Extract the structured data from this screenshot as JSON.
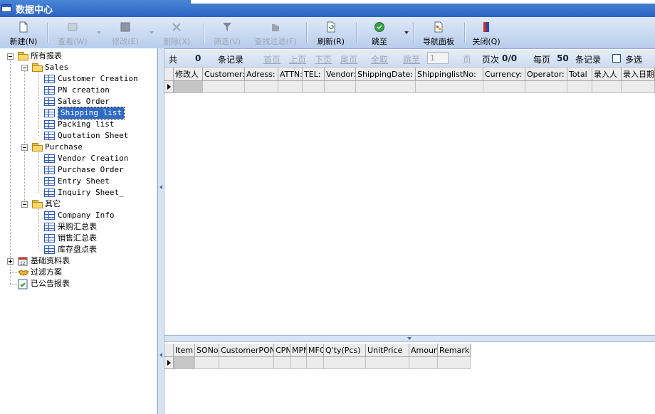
{
  "window": {
    "title": "数据中心"
  },
  "toolbar": {
    "new": "新建(N)",
    "view": "查看(W)",
    "edit": "修改(E)",
    "delete": "删除(X)",
    "filter": "筛选(V)",
    "find_filter": "查找过滤(F)",
    "refresh": "刷新(R)",
    "jump": "跳至",
    "nav_panel": "导航面板",
    "close": "关闭(Q)"
  },
  "tree": {
    "root": "所有报表",
    "sales": {
      "label": "Sales",
      "items": [
        "Customer Creation",
        "PN creation",
        "Sales Order",
        "Shipping list",
        "Packing list",
        "Quotation Sheet"
      ],
      "selected": "Shipping list"
    },
    "purchase": {
      "label": "Purchase",
      "items": [
        "Vendor Creation",
        "Purchase Order",
        "Entry Sheet",
        "Inquiry Sheet_"
      ]
    },
    "other": {
      "label": "其它",
      "items": [
        "Company Info",
        "采购汇总表",
        "销售汇总表",
        "库存盘点表"
      ]
    },
    "basic": "基础资料表",
    "filter_scheme": "过滤方案",
    "published": "已公告报表"
  },
  "navbar": {
    "total_prefix": "共",
    "total_count": "0",
    "records_label": "条记录",
    "first": "首页",
    "prev": "上页",
    "next": "下页",
    "last": "尾页",
    "select_all": "全取",
    "jump_to": "跳至",
    "page_input": "1",
    "page_unit": "页",
    "page_label": "页次",
    "page_value": "0/0",
    "per_page_label": "每页",
    "per_page_value": "50",
    "per_page_records": "条记录",
    "multi_select": "多选"
  },
  "main_grid": {
    "columns": [
      "修改人",
      "Customer:",
      "Adress:",
      "ATTN:",
      "TEL:",
      "Vendor:",
      "ShippingDate:",
      "ShippinglistNo:",
      "Currency:",
      "Operator:",
      "Total",
      "录入人",
      "录入日期"
    ]
  },
  "detail_grid": {
    "columns": [
      "Item",
      "SONo.",
      "CustomerPONo",
      "CPN",
      "MPN",
      "MFG",
      "Q'ty(Pcs)",
      "UnitPrice",
      "Amount",
      "Remarks"
    ]
  },
  "colors": {
    "title_bar": "#2d62c1",
    "selection": "#316ac5",
    "toolbar": "#c9daf1"
  },
  "icons": [
    "window-icon",
    "new-doc-icon",
    "view-icon",
    "edit-icon",
    "delete-icon",
    "filter-icon",
    "find-filter-icon",
    "refresh-icon",
    "jump-icon",
    "nav-panel-icon",
    "close-door-icon",
    "folder-icon",
    "grid-report-icon",
    "calendar-icon",
    "handshake-icon",
    "published-report-icon"
  ]
}
